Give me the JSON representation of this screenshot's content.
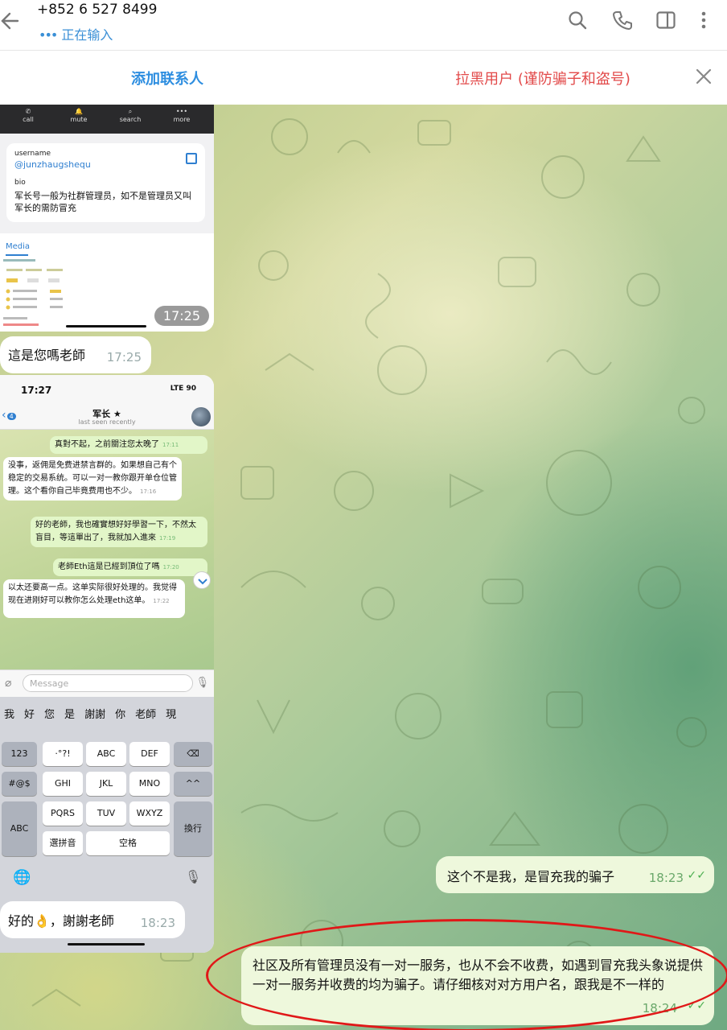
{
  "header": {
    "title": "+852 6 527 8499",
    "status_dots": "•••",
    "status": "正在输入",
    "icons": [
      "back-arrow-icon",
      "search-icon",
      "phone-icon",
      "sidebar-icon",
      "more-vert-icon"
    ]
  },
  "actionbar": {
    "add_contact": "添加联系人",
    "block_user": "拉黑用户 (谨防骗子和盗号)"
  },
  "shot1": {
    "buttons": [
      "call",
      "mute",
      "search",
      "more"
    ],
    "username_label": "username",
    "username": "@junzhaugshequ",
    "bio_label": "bio",
    "bio": "军长号一般为社群管理员，如不是管理员又叫军长的需防冒充",
    "media_label": "Media",
    "time": "17:25"
  },
  "messages": [
    {
      "dir": "in",
      "text": "這是您嗎老師",
      "time": "17:25"
    },
    {
      "dir": "out",
      "text": "这个不是我，是冒充我的骗子",
      "time": "18:23"
    },
    {
      "dir": "in",
      "text": "好的👌，謝謝老師",
      "time": "18:23"
    },
    {
      "dir": "out",
      "text": "社区及所有管理员没有一对一服务，也从不会不收费，如遇到冒充我头象说提供一对一服务并收费的均为骗子。请仔细核对对方用户名，跟我是不一样的",
      "time": "18:24"
    }
  ],
  "shot2": {
    "status_time": "17:27",
    "status_right": "LTE 90",
    "back_count": "4",
    "chat_name": "军长 ★",
    "last_seen": "last seen recently",
    "msgs": [
      {
        "dir": "out",
        "text": "真對不起，之前關注您太晚了",
        "time": "17:11"
      },
      {
        "dir": "in",
        "text": "没事，返佣是免费进禁言群的。如果想自己有个稳定的交易系统。可以一对一教你跟开单仓位管理。这个看你自己毕竟费用也不少。",
        "time": "17:16"
      },
      {
        "dir": "out",
        "text": "好的老師，我也確實想好好學習一下，不然太盲目，等這單出了，我就加入進來",
        "time": "17:19"
      },
      {
        "dir": "out",
        "text": "老師Eth這是已經到頂位了嗎",
        "time": "17:20"
      },
      {
        "dir": "in",
        "text": "以太还要高一点。这单实际很好处理的。我觉得现在进刚好可以教你怎么处理eth这单。",
        "time": "17:22"
      }
    ],
    "message_placeholder": "Message",
    "candidates": [
      "我",
      "好",
      "您",
      "是",
      "謝謝",
      "你",
      "老師",
      "現"
    ],
    "keys": {
      "k123": "123",
      "punct": "·°?!",
      "abc": "ABC",
      "def": "DEF",
      "sym": "#@$",
      "ghi": "GHI",
      "jkl": "JKL",
      "mno": "MNO",
      "face": "^^",
      "abc_mode": "ABC",
      "pqrs": "PQRS",
      "tuv": "TUV",
      "wxyz": "WXYZ",
      "pinyin": "選拼音",
      "space": "空格",
      "return": "換行"
    }
  },
  "colors": {
    "accent": "#2e8ee0",
    "danger": "#e24a4a",
    "out_bubble": "#eef8dc",
    "oval": "#e01818"
  }
}
